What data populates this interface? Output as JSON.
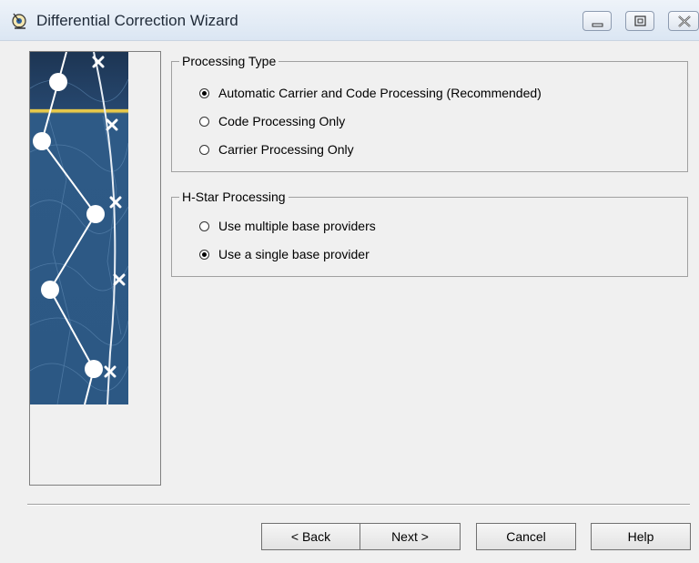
{
  "window": {
    "title": "Differential Correction Wizard",
    "icon": "satellite-dish-icon",
    "controls": {
      "minimize": "minimize-icon",
      "maximize": "maximize-icon",
      "close": "close-icon"
    }
  },
  "processing_type": {
    "legend": "Processing Type",
    "options": [
      {
        "label": "Automatic Carrier and Code Processing (Recommended)",
        "checked": true
      },
      {
        "label": "Code Processing Only",
        "checked": false
      },
      {
        "label": "Carrier Processing Only",
        "checked": false
      }
    ]
  },
  "hstar_processing": {
    "legend": "H-Star Processing",
    "options": [
      {
        "label": "Use multiple base providers",
        "checked": false
      },
      {
        "label": "Use a single base provider",
        "checked": true
      }
    ]
  },
  "buttons": {
    "back": "< Back",
    "next": "Next >",
    "cancel": "Cancel",
    "help": "Help"
  },
  "colors": {
    "art_background": "#2e5a86",
    "art_accent": "#e6c84a",
    "titlebar": "#dbe6f3"
  }
}
